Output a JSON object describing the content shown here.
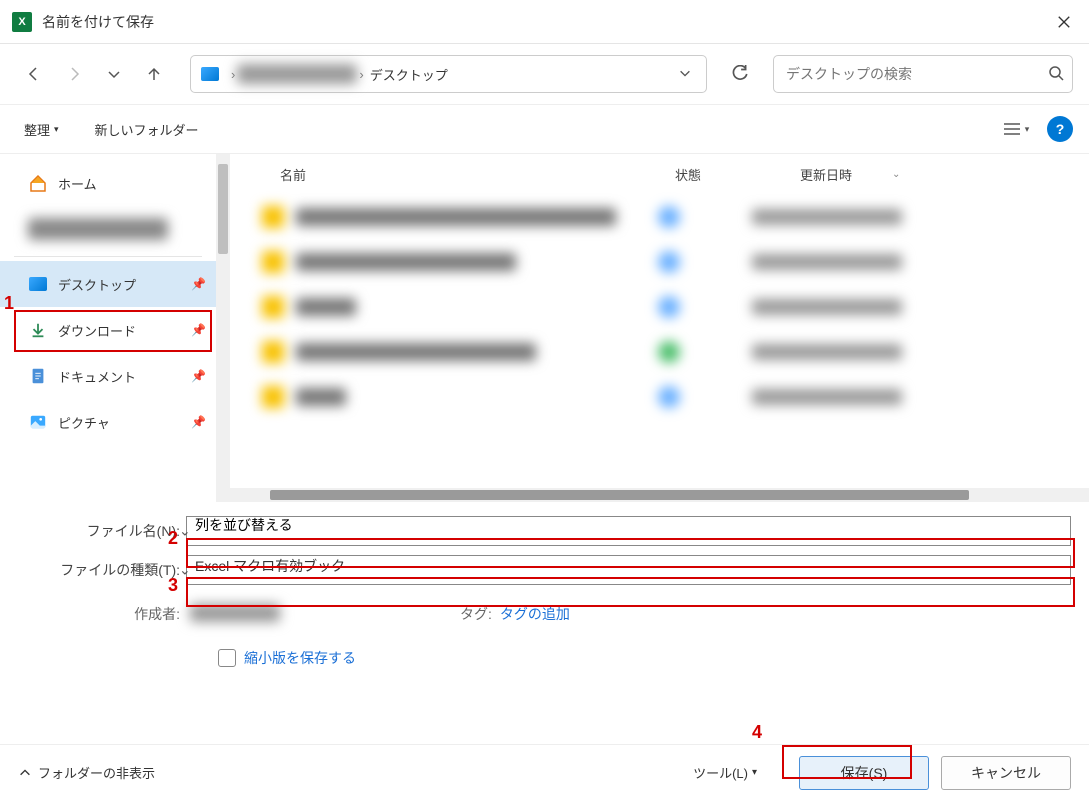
{
  "title": "名前を付けて保存",
  "excel_icon_text": "X",
  "nav": {
    "crumb_last": "デスクトップ"
  },
  "search": {
    "placeholder": "デスクトップの検索"
  },
  "toolbar": {
    "organize": "整理",
    "new_folder": "新しいフォルダー",
    "help": "?"
  },
  "sidebar": {
    "home": "ホーム",
    "desktop": "デスクトップ",
    "downloads": "ダウンロード",
    "documents": "ドキュメント",
    "pictures": "ピクチャ"
  },
  "columns": {
    "name": "名前",
    "status": "状態",
    "date": "更新日時"
  },
  "form": {
    "filename_label": "ファイル名(N):",
    "filename_value": "列を並び替える",
    "filetype_label": "ファイルの種類(T):",
    "filetype_value": "Excel マクロ有効ブック",
    "author_label": "作成者:",
    "tag_label": "タグ:",
    "tag_link": "タグの追加",
    "thumb_label": "縮小版を保存する"
  },
  "footer": {
    "hide_folders": "フォルダーの非表示",
    "tools": "ツール(L)",
    "save": "保存(S)",
    "cancel": "キャンセル"
  },
  "annotations": {
    "a1": "1",
    "a2": "2",
    "a3": "3",
    "a4": "4"
  }
}
